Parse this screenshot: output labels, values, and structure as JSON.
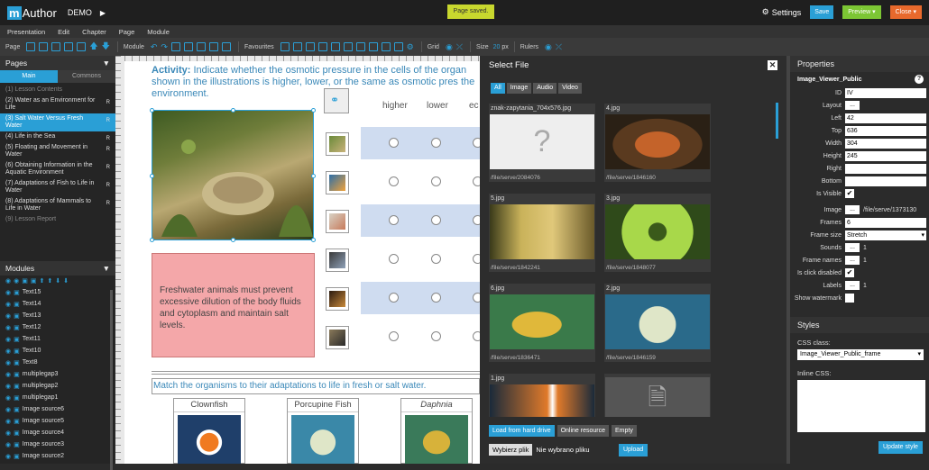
{
  "app": {
    "logo_m": "m",
    "logo_author": "Author",
    "project": "DEMO",
    "toast": "Page saved.",
    "settings": "Settings",
    "save": "Save",
    "preview": "Preview",
    "close": "Close"
  },
  "menu": [
    "Presentation",
    "Edit",
    "Chapter",
    "Page",
    "Module"
  ],
  "toolbar": {
    "page": "Page",
    "module": "Module",
    "favourites": "Favourites",
    "grid": "Grid",
    "size": "Size",
    "size_value": "20",
    "size_unit": "px",
    "rulers": "Rulers"
  },
  "pages_panel": {
    "title": "Pages",
    "tabs": [
      "Main",
      "Commons"
    ],
    "items": [
      {
        "label": "(1) Lesson Contents",
        "r": ""
      },
      {
        "label": "(2) Water as an Environment for Life",
        "r": "R"
      },
      {
        "label": "(3) Salt Water Versus Fresh Water",
        "r": "R"
      },
      {
        "label": "(4) Life in the Sea",
        "r": "R"
      },
      {
        "label": "(5) Floating and Movement in Water",
        "r": "R"
      },
      {
        "label": "(6) Obtaining Information in the Aquatic Environment",
        "r": "R"
      },
      {
        "label": "(7) Adaptations of Fish to Life in Water",
        "r": "R"
      },
      {
        "label": "(8) Adaptations of Mammals to Life in Water",
        "r": "R"
      },
      {
        "label": "(9) Lesson Report",
        "r": ""
      }
    ]
  },
  "modules_panel": {
    "title": "Modules",
    "items": [
      "Text15",
      "Text14",
      "Text13",
      "Text12",
      "Text11",
      "Text10",
      "Text8",
      "multiplegap3",
      "multiplegap2",
      "multiplegap1",
      "Image source6",
      "Image source5",
      "Image source4",
      "Image source3",
      "Image source2"
    ]
  },
  "canvas": {
    "activity_label": "Activity:",
    "activity_text": "Indicate whether the osmotic pressure in the cells of the organ shown in the illustrations is higher, lower, or the same as osmotic pres the environment.",
    "col_higher": "higher",
    "col_lower": "lower",
    "col_equal": "ec",
    "pink_text": "Freshwater animals must prevent excessive dilution of the body fluids and cytoplasm and maintain salt levels.",
    "match_text": "Match the organisms to their adaptations to life in fresh or salt water.",
    "cards": [
      "Clownfish",
      "Porcupine Fish",
      "Daphnia"
    ]
  },
  "dialog": {
    "title": "Select File",
    "filters": [
      "All",
      "Image",
      "Audio",
      "Video"
    ],
    "files": [
      {
        "name": "znak-zapytania_704x576.jpg",
        "path": "/file/serve/2084076"
      },
      {
        "name": "4.jpg",
        "path": "/file/serve/1846160"
      },
      {
        "name": "5.jpg",
        "path": "/file/serve/1842241"
      },
      {
        "name": "3.jpg",
        "path": "/file/serve/1848077"
      },
      {
        "name": "6.jpg",
        "path": "/file/serve/1836471"
      },
      {
        "name": "2.jpg",
        "path": "/file/serve/1846159"
      },
      {
        "name": "1.jpg",
        "path": ""
      },
      {
        "name": "",
        "path": ""
      }
    ],
    "btn_hd": "Load from hard drive",
    "btn_online": "Online resource",
    "btn_empty": "Empty",
    "choose": "Wybierz plik",
    "no_file": "Nie wybrano pliku",
    "upload": "Upload"
  },
  "properties": {
    "title": "Properties",
    "module_name": "Image_Viewer_Public",
    "id_label": "ID",
    "id": "IV",
    "layout_label": "Layout",
    "dots": "...",
    "left_label": "Left",
    "left": "42",
    "top_label": "Top",
    "top": "636",
    "width_label": "Width",
    "width": "304",
    "height_label": "Height",
    "height": "245",
    "right_label": "Right",
    "bottom_label": "Bottom",
    "visible_label": "Is Visible",
    "image_label": "Image",
    "image": "/file/serve/1373130",
    "frames_label": "Frames",
    "frames": "6",
    "framesize_label": "Frame size",
    "framesize": "Stretch",
    "sounds_label": "Sounds",
    "sounds": "1",
    "framenames_label": "Frame names",
    "framenames": "1",
    "clickdisabled_label": "Is click disabled",
    "labels_label": "Labels",
    "labels": "1",
    "watermark_label": "Show watermark",
    "styles_title": "Styles",
    "css_class_label": "CSS class:",
    "css_class": "Image_Viewer_Public_frame",
    "inline_css_label": "Inline CSS:",
    "update_style": "Update style"
  }
}
